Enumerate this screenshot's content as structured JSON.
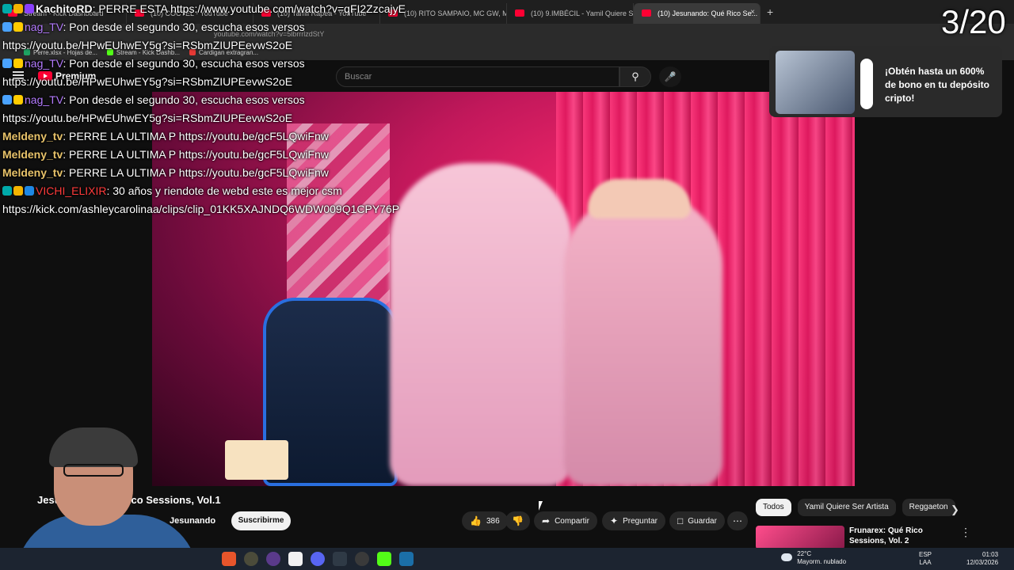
{
  "stream_counter": "3/20",
  "browser": {
    "tabs": [
      {
        "label": "Stream - Kick Dashboard",
        "active": false
      },
      {
        "label": "(10) COCTEL - YouTube",
        "active": false
      },
      {
        "label": "(10) Yamil Rapea - YouTube",
        "active": false
      },
      {
        "label": "(10) RITO SAMPAIO, MC GW, MC P...",
        "active": false
      },
      {
        "label": "(10) 9.IMBÉCIL - Yamil Quiere Ser Arti...",
        "active": false
      },
      {
        "label": "(10) Jesunando: Qué Rico Se...",
        "active": true
      }
    ],
    "url": "youtube.com/watch?v=5lbrrrlzdStY",
    "bookmarks": [
      {
        "label": "Perre.xlsx - Hojas de...",
        "color": "#1ea362"
      },
      {
        "label": "Stream - Kick Dashb...",
        "color": "#53fc18"
      },
      {
        "label": "Cardigan extragran...",
        "color": "#e53935"
      }
    ]
  },
  "youtube": {
    "logo_text": "Premium",
    "search_placeholder": "Buscar",
    "video_title": "Jesunando: Qué Rico Sessions, Vol.1",
    "channel_name": "Jesunando",
    "subscribe_label": "Suscribirme",
    "like_count": "386",
    "share_label": "Compartir",
    "ask_label": "Preguntar",
    "save_label": "Guardar",
    "chips": [
      "Todos",
      "Yamil Quiere Ser Artista",
      "Reggaeton"
    ],
    "recommended": {
      "title": "Frunarex: Qué Rico Sessions, Vol. 2"
    }
  },
  "ad": {
    "text": "¡Obtén hasta un 600% de bono en tu depósito cripto!"
  },
  "chat": [
    {
      "user": "KachitoRD",
      "message": ": PERRE ESTA https://www.youtube.com/watch?v=qFI2ZzcajyE",
      "style": "u1"
    },
    {
      "user": "nag_TV",
      "message": ": Pon desde el segundo 30, escucha esos versos",
      "style": "u2"
    },
    {
      "user": "",
      "message": "https://youtu.be/HPwEUhwEY5g?si=RSbmZIUPEevwS2oE",
      "style": ""
    },
    {
      "user": "nag_TV",
      "message": ": Pon desde el segundo 30, escucha esos versos",
      "style": "u2"
    },
    {
      "user": "",
      "message": "https://youtu.be/HPwEUhwEY5g?si=RSbmZIUPEevwS2oE",
      "style": ""
    },
    {
      "user": "nag_TV",
      "message": ": Pon desde el segundo 30, escucha esos versos",
      "style": "u2"
    },
    {
      "user": "",
      "message": "https://youtu.be/HPwEUhwEY5g?si=RSbmZIUPEevwS2oE",
      "style": ""
    },
    {
      "user": "Meldeny_tv",
      "message": ": PERRE LA ULTIMA P https://youtu.be/gcF5LQwiFnw",
      "style": "u3"
    },
    {
      "user": "Meldeny_tv",
      "message": ": PERRE LA ULTIMA P https://youtu.be/gcF5LQwiFnw",
      "style": "u3"
    },
    {
      "user": "Meldeny_tv",
      "message": ": PERRE LA ULTIMA P https://youtu.be/gcF5LQwiFnw",
      "style": "u3"
    },
    {
      "user": "VICHI_ELIXIR",
      "message": ": 30 años y riendote de webd este es mejor csm",
      "style": "u4"
    },
    {
      "user": "",
      "message": "https://kick.com/ashleycarolinaa/clips/clip_01KK5XAJNDQ6WDW009Q1CPY76P",
      "style": ""
    }
  ],
  "taskbar": {
    "weather_temp": "22°C",
    "weather_desc": "Mayorm. nublado",
    "lang_top": "ESP",
    "lang_bottom": "LAA",
    "time": "01:03",
    "date": "12/03/2026"
  }
}
